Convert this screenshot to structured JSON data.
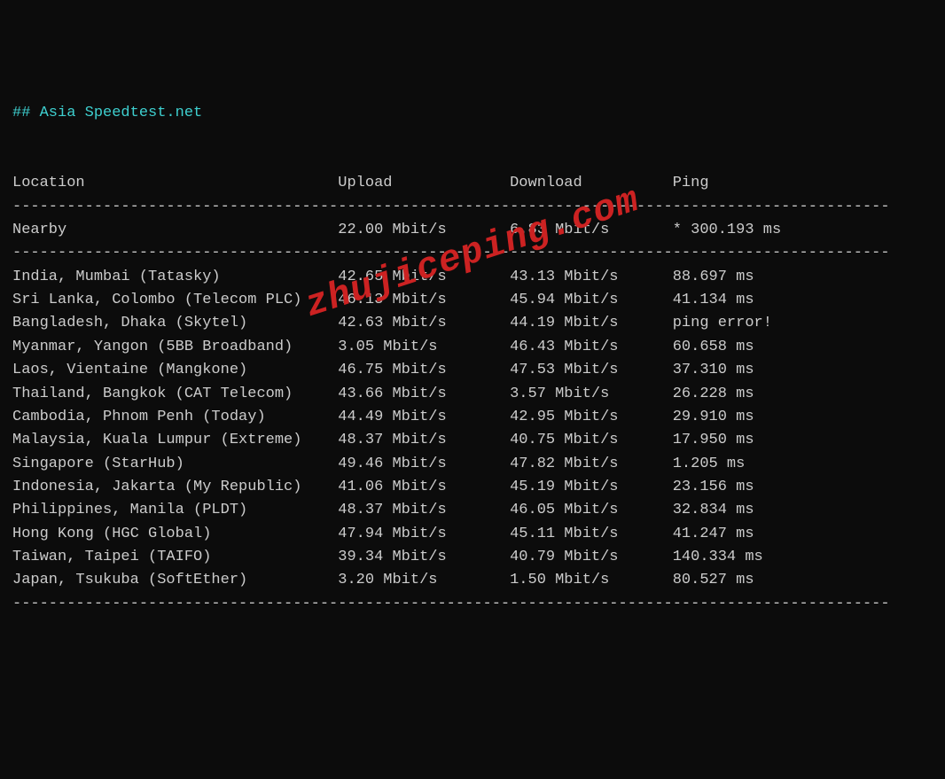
{
  "header": "## Asia Speedtest.net",
  "columns": {
    "location": "Location",
    "upload": "Upload",
    "download": "Download",
    "ping": "Ping"
  },
  "nearby": {
    "label": "Nearby",
    "upload": "22.00 Mbit/s",
    "download": "6.83 Mbit/s",
    "ping": "* 300.193 ms"
  },
  "rows": [
    {
      "location": "India, Mumbai (Tatasky)",
      "upload": "42.65 Mbit/s",
      "download": "43.13 Mbit/s",
      "ping": "88.697 ms"
    },
    {
      "location": "Sri Lanka, Colombo (Telecom PLC)",
      "upload": "46.13 Mbit/s",
      "download": "45.94 Mbit/s",
      "ping": "41.134 ms"
    },
    {
      "location": "Bangladesh, Dhaka (Skytel)",
      "upload": "42.63 Mbit/s",
      "download": "44.19 Mbit/s",
      "ping": "ping error!"
    },
    {
      "location": "Myanmar, Yangon (5BB Broadband)",
      "upload": "3.05 Mbit/s",
      "download": "46.43 Mbit/s",
      "ping": "60.658 ms"
    },
    {
      "location": "Laos, Vientaine (Mangkone)",
      "upload": "46.75 Mbit/s",
      "download": "47.53 Mbit/s",
      "ping": "37.310 ms"
    },
    {
      "location": "Thailand, Bangkok (CAT Telecom)",
      "upload": "43.66 Mbit/s",
      "download": "3.57 Mbit/s",
      "ping": "26.228 ms"
    },
    {
      "location": "Cambodia, Phnom Penh (Today)",
      "upload": "44.49 Mbit/s",
      "download": "42.95 Mbit/s",
      "ping": "29.910 ms"
    },
    {
      "location": "Malaysia, Kuala Lumpur (Extreme)",
      "upload": "48.37 Mbit/s",
      "download": "40.75 Mbit/s",
      "ping": "17.950 ms"
    },
    {
      "location": "Singapore (StarHub)",
      "upload": "49.46 Mbit/s",
      "download": "47.82 Mbit/s",
      "ping": "1.205 ms"
    },
    {
      "location": "Indonesia, Jakarta (My Republic)",
      "upload": "41.06 Mbit/s",
      "download": "45.19 Mbit/s",
      "ping": "23.156 ms"
    },
    {
      "location": "Philippines, Manila (PLDT)",
      "upload": "48.37 Mbit/s",
      "download": "46.05 Mbit/s",
      "ping": "32.834 ms"
    },
    {
      "location": "Hong Kong (HGC Global)",
      "upload": "47.94 Mbit/s",
      "download": "45.11 Mbit/s",
      "ping": "41.247 ms"
    },
    {
      "location": "Taiwan, Taipei (TAIFO)",
      "upload": "39.34 Mbit/s",
      "download": "40.79 Mbit/s",
      "ping": "140.334 ms"
    },
    {
      "location": "Japan, Tsukuba (SoftEther)",
      "upload": "3.20 Mbit/s",
      "download": "1.50 Mbit/s",
      "ping": "80.527 ms"
    }
  ],
  "watermark": "zhujiceping.com",
  "layout": {
    "col_location_width": 36,
    "col_upload_width": 19,
    "col_download_width": 18,
    "dash_count": 97
  }
}
